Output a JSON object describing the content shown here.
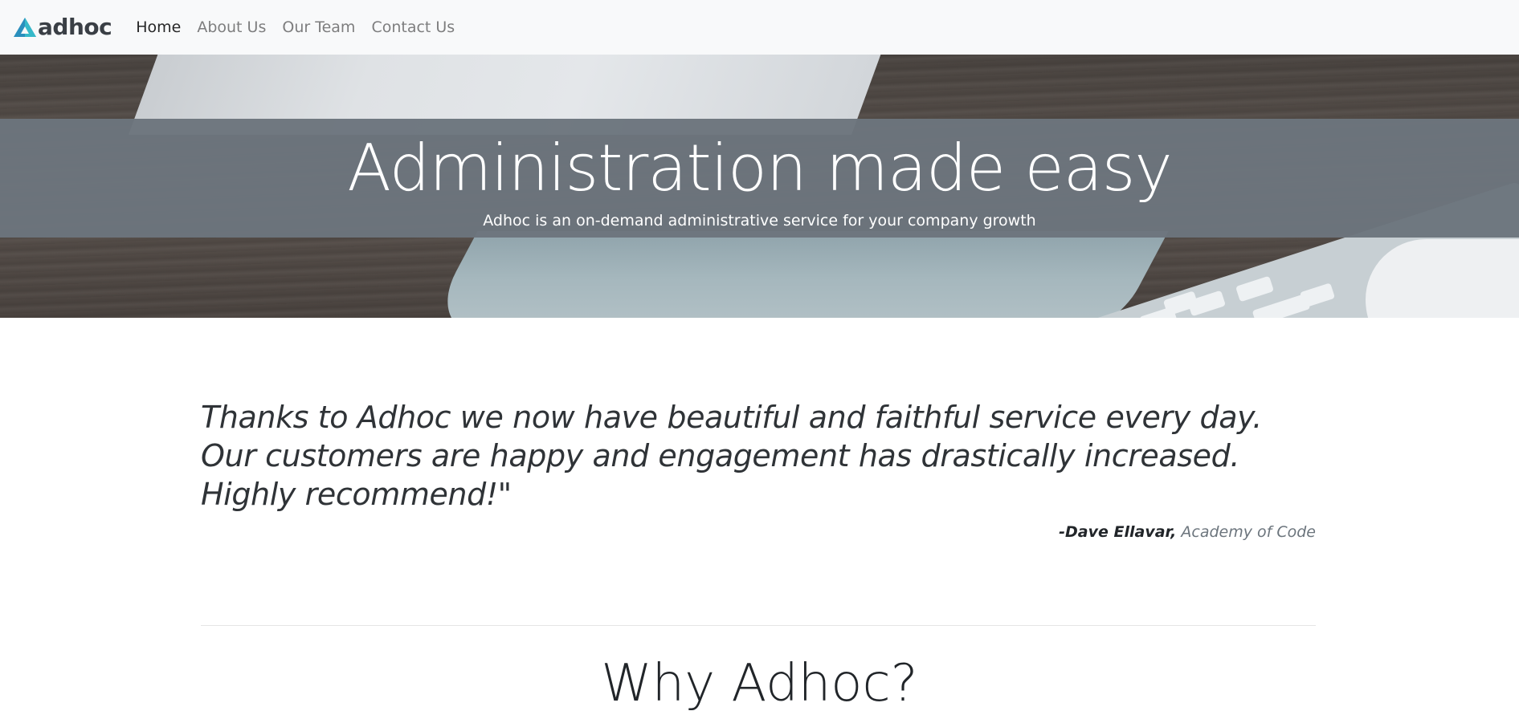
{
  "navbar": {
    "brand": "adhoc",
    "links": [
      {
        "label": "Home",
        "active": true
      },
      {
        "label": "About Us",
        "active": false
      },
      {
        "label": "Our Team",
        "active": false
      },
      {
        "label": "Contact Us",
        "active": false
      }
    ]
  },
  "hero": {
    "title": "Administration made easy",
    "subtitle": "Adhoc is an on-demand administrative service for your company growth"
  },
  "testimonial": {
    "quote": "Thanks to Adhoc we now have beautiful and faithful service every day. Our customers are happy and engagement has drastically increased. Highly recommend!\"",
    "author": "-Dave Ellavar,",
    "company": "Academy of Code"
  },
  "section": {
    "title": "Why Adhoc?"
  },
  "colors": {
    "navbar_bg": "#f8f9fa",
    "hero_band": "#6c757d",
    "logo_blue": "#2a8fbd",
    "logo_teal": "#36b9c9"
  },
  "icons": {
    "logo": "triangle-logo-icon"
  }
}
